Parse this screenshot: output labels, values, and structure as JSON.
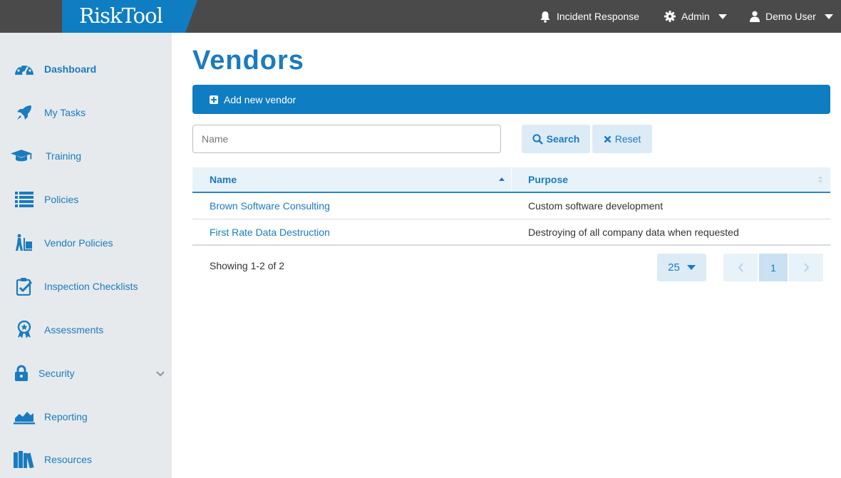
{
  "topbar": {
    "logo": "RiskTool",
    "incident": "Incident Response",
    "admin": "Admin",
    "user": "Demo User"
  },
  "sidebar": {
    "items": [
      {
        "label": "Dashboard",
        "icon": "dashboard-icon"
      },
      {
        "label": "My Tasks",
        "icon": "rocket-icon"
      },
      {
        "label": "Training",
        "icon": "graduation-cap-icon"
      },
      {
        "label": "Policies",
        "icon": "list-icon"
      },
      {
        "label": "Vendor Policies",
        "icon": "vendor-dolly-icon"
      },
      {
        "label": "Inspection Checklists",
        "icon": "clipboard-check-icon"
      },
      {
        "label": "Assessments",
        "icon": "award-icon"
      },
      {
        "label": "Security",
        "icon": "lock-icon"
      },
      {
        "label": "Reporting",
        "icon": "area-chart-icon"
      },
      {
        "label": "Resources",
        "icon": "books-icon"
      }
    ]
  },
  "main": {
    "title": "Vendors",
    "add_label": "Add new vendor",
    "search": {
      "placeholder": "Name",
      "value": ""
    },
    "search_label": "Search",
    "reset_label": "Reset"
  },
  "table": {
    "columns": [
      "Name",
      "Purpose"
    ],
    "rows": [
      {
        "name": "Brown Software Consulting",
        "purpose": "Custom software development"
      },
      {
        "name": "First Rate Data Destruction",
        "purpose": "Destroying of all company data when requested"
      }
    ]
  },
  "footer": {
    "showing": "Showing 1-2 of 2",
    "per_page": "25",
    "current_page": "1"
  },
  "colors": {
    "accent": "#0f7dc2",
    "topbar": "#4a4a4a",
    "sidebar": "#e7eaec",
    "light_button": "#dcebf6"
  }
}
